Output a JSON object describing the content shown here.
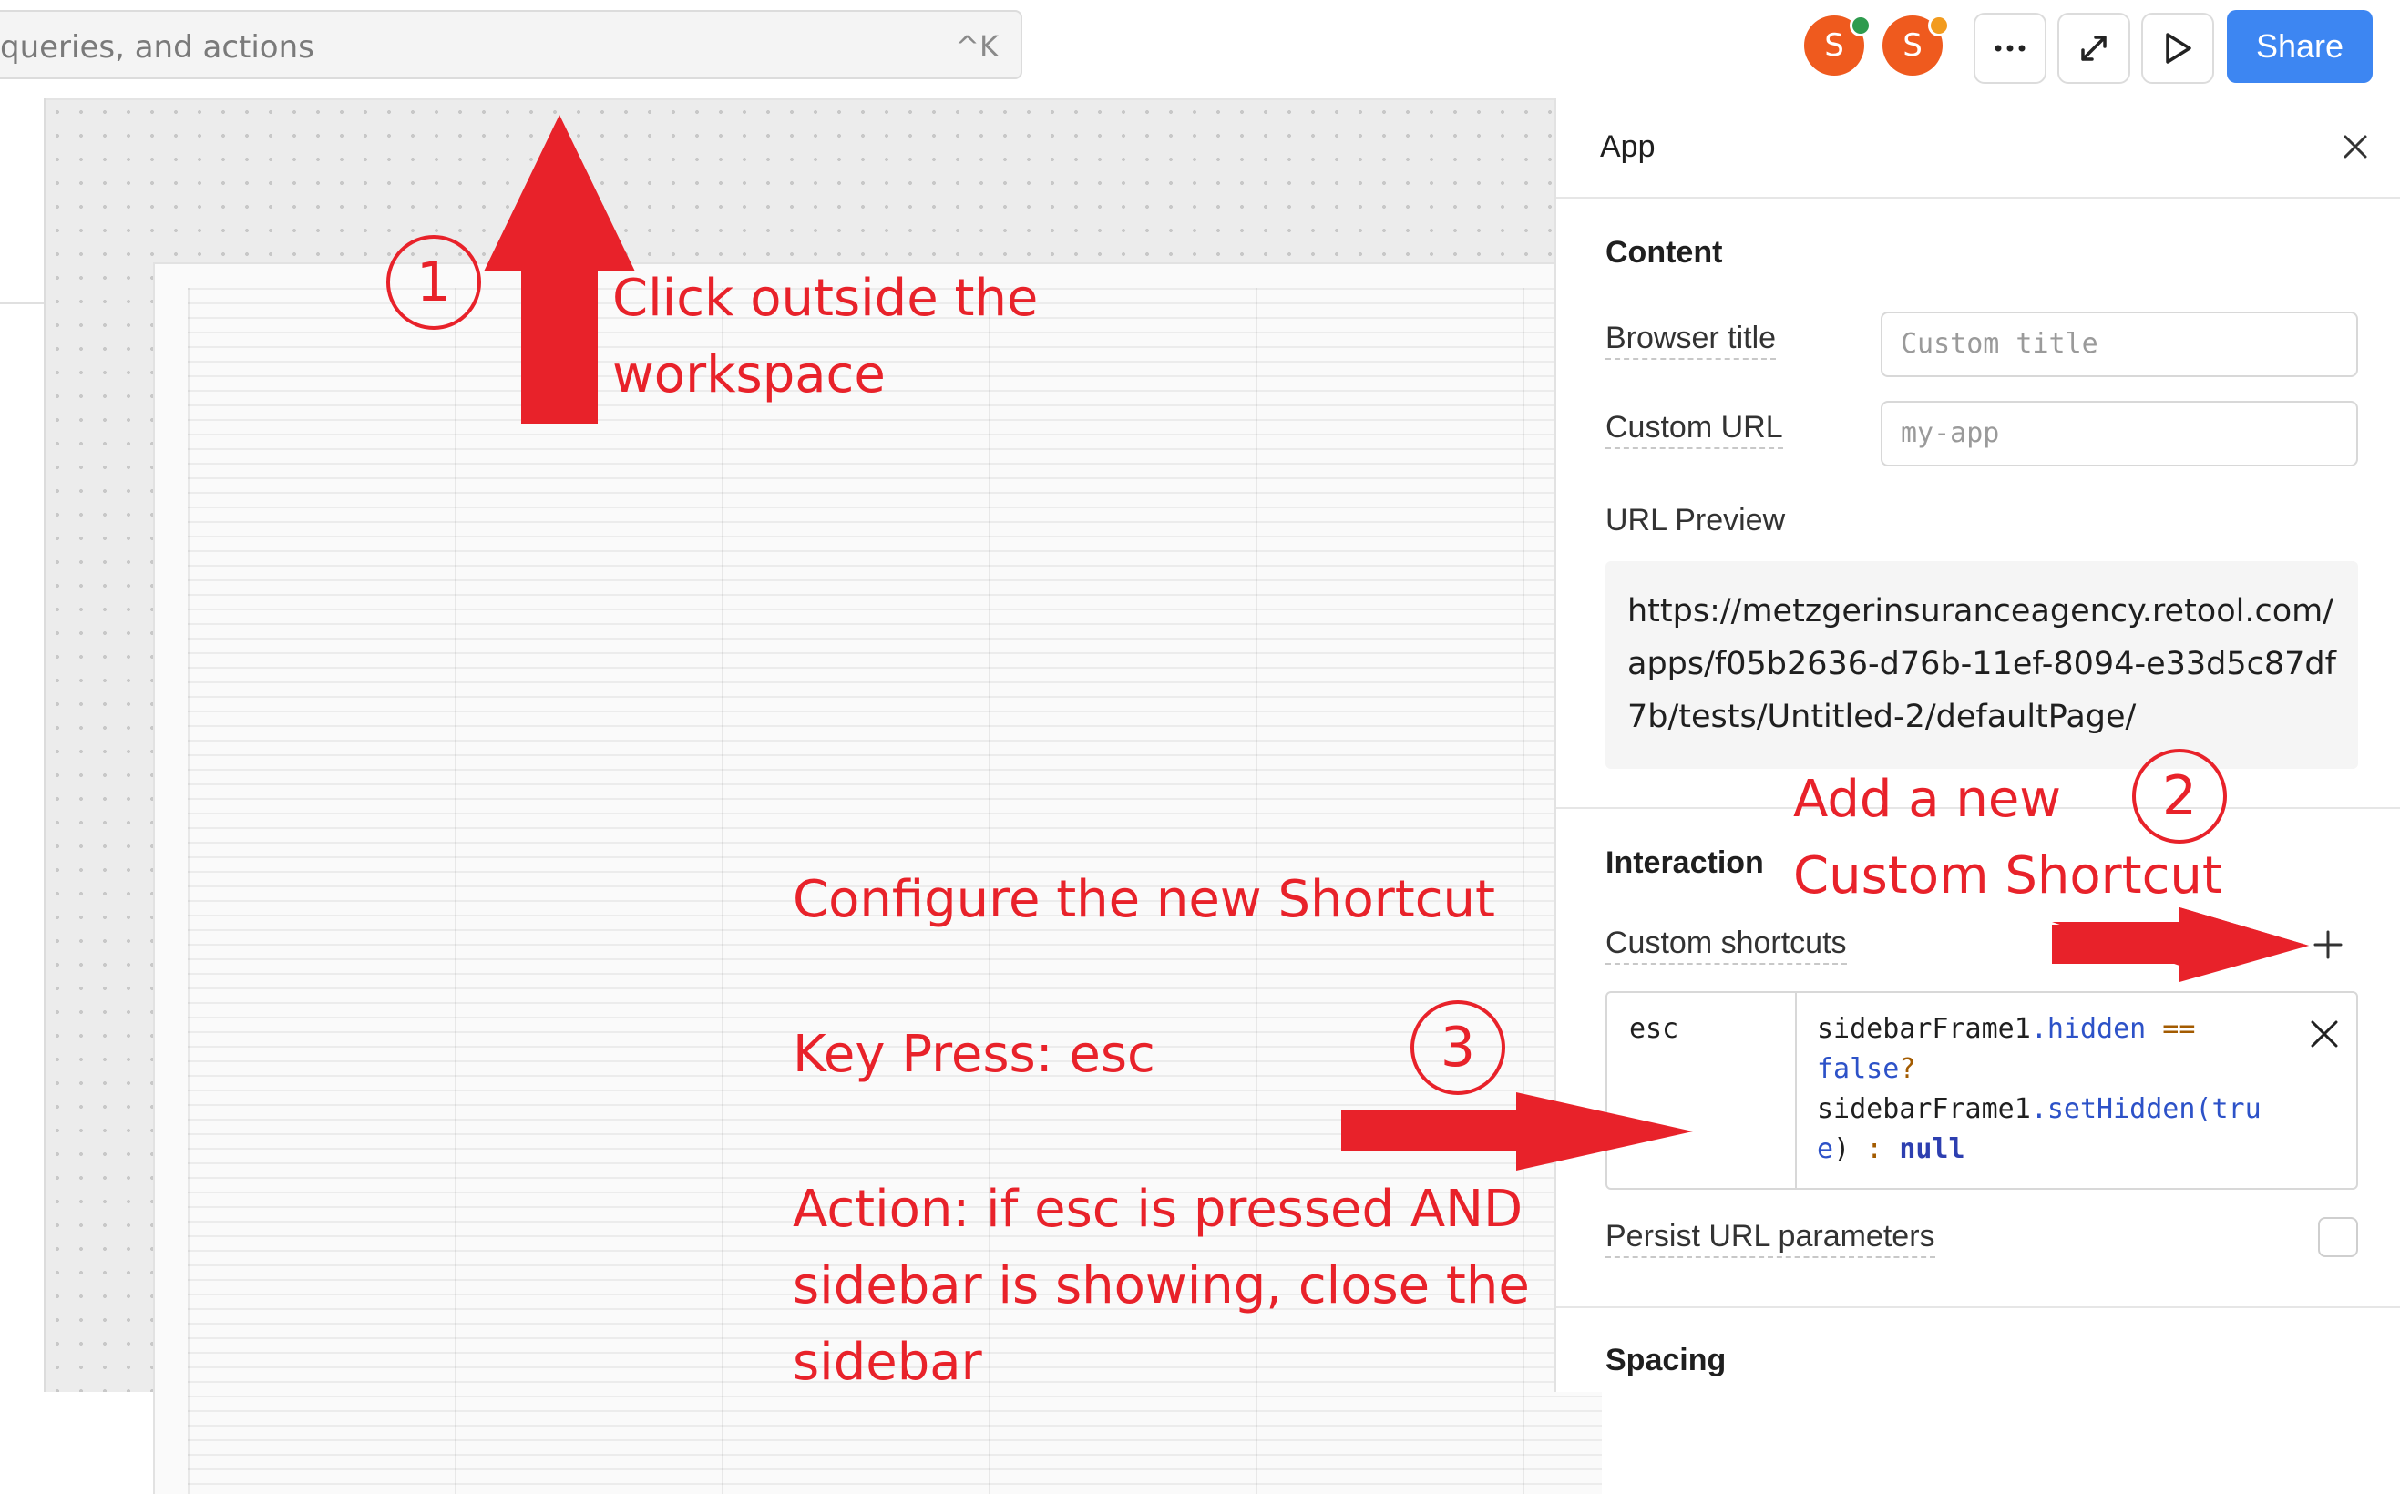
{
  "search": {
    "placeholder_fragment": "queries, and actions",
    "shortcut": "^K"
  },
  "avatars": [
    {
      "initial": "S",
      "status_color": "#2e9b4e"
    },
    {
      "initial": "S",
      "status_color": "#f29b1e"
    }
  ],
  "toolbar": {
    "share_label": "Share"
  },
  "panel": {
    "title": "App",
    "content": {
      "heading": "Content",
      "browser_title_label": "Browser title",
      "browser_title_placeholder": "Custom title",
      "custom_url_label": "Custom URL",
      "custom_url_placeholder": "my-app",
      "url_preview_label": "URL Preview",
      "url_preview": "https://metzgerinsuranceagency.retool.com/apps/f05b2636-d76b-11ef-8094-e33d5c87df7b/tests/Untitled-2/defaultPage/"
    },
    "interaction": {
      "heading": "Interaction",
      "custom_shortcuts_label": "Custom shortcuts",
      "shortcut": {
        "key": "esc",
        "code_obj": "sidebarFrame1",
        "code_prop": ".hidden",
        "code_eq": " ==",
        "code_false": "false",
        "code_q": "?",
        "code_obj2": "sidebarFrame1",
        "code_method": ".setHidden(",
        "code_arg": "true",
        "code_close": ")",
        "code_colon": " : ",
        "code_null": "null"
      },
      "persist_label": "Persist URL parameters"
    },
    "spacing": {
      "heading": "Spacing"
    }
  },
  "annotations": {
    "step1_number": "1",
    "step1_text": [
      "Click outside the",
      "workspace"
    ],
    "step2_number": "2",
    "step2_text": [
      "Add a new",
      "Custom Shortcut"
    ],
    "step3_number": "3",
    "configure_title": "Configure the new Shortcut",
    "key_press": "Key Press:  esc",
    "action_lines": [
      "Action: if esc is pressed AND",
      "sidebar is showing, close the",
      "sidebar"
    ],
    "color": "#e8222a"
  }
}
